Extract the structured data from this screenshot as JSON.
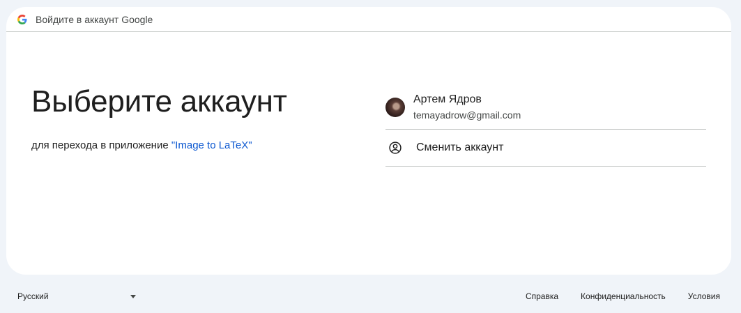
{
  "header": {
    "title": "Войдите в аккаунт Google",
    "logo_icon": "google-g-icon"
  },
  "main": {
    "title": "Выберите аккаунт",
    "subtitle_prefix": "для перехода в приложение ",
    "app_name": "\"Image to LaTeX\""
  },
  "accounts": [
    {
      "name": "Артем Ядров",
      "email": "temayadrow@gmail.com"
    }
  ],
  "switch_account": {
    "label": "Сменить аккаунт",
    "icon": "account-circle-icon"
  },
  "footer": {
    "language": "Русский",
    "help": "Справка",
    "privacy": "Конфиденциальность",
    "terms": "Условия"
  },
  "colors": {
    "accent": "#0b57d0",
    "background": "#f0f4f9",
    "card": "#ffffff",
    "divider": "#c4c7c5"
  }
}
